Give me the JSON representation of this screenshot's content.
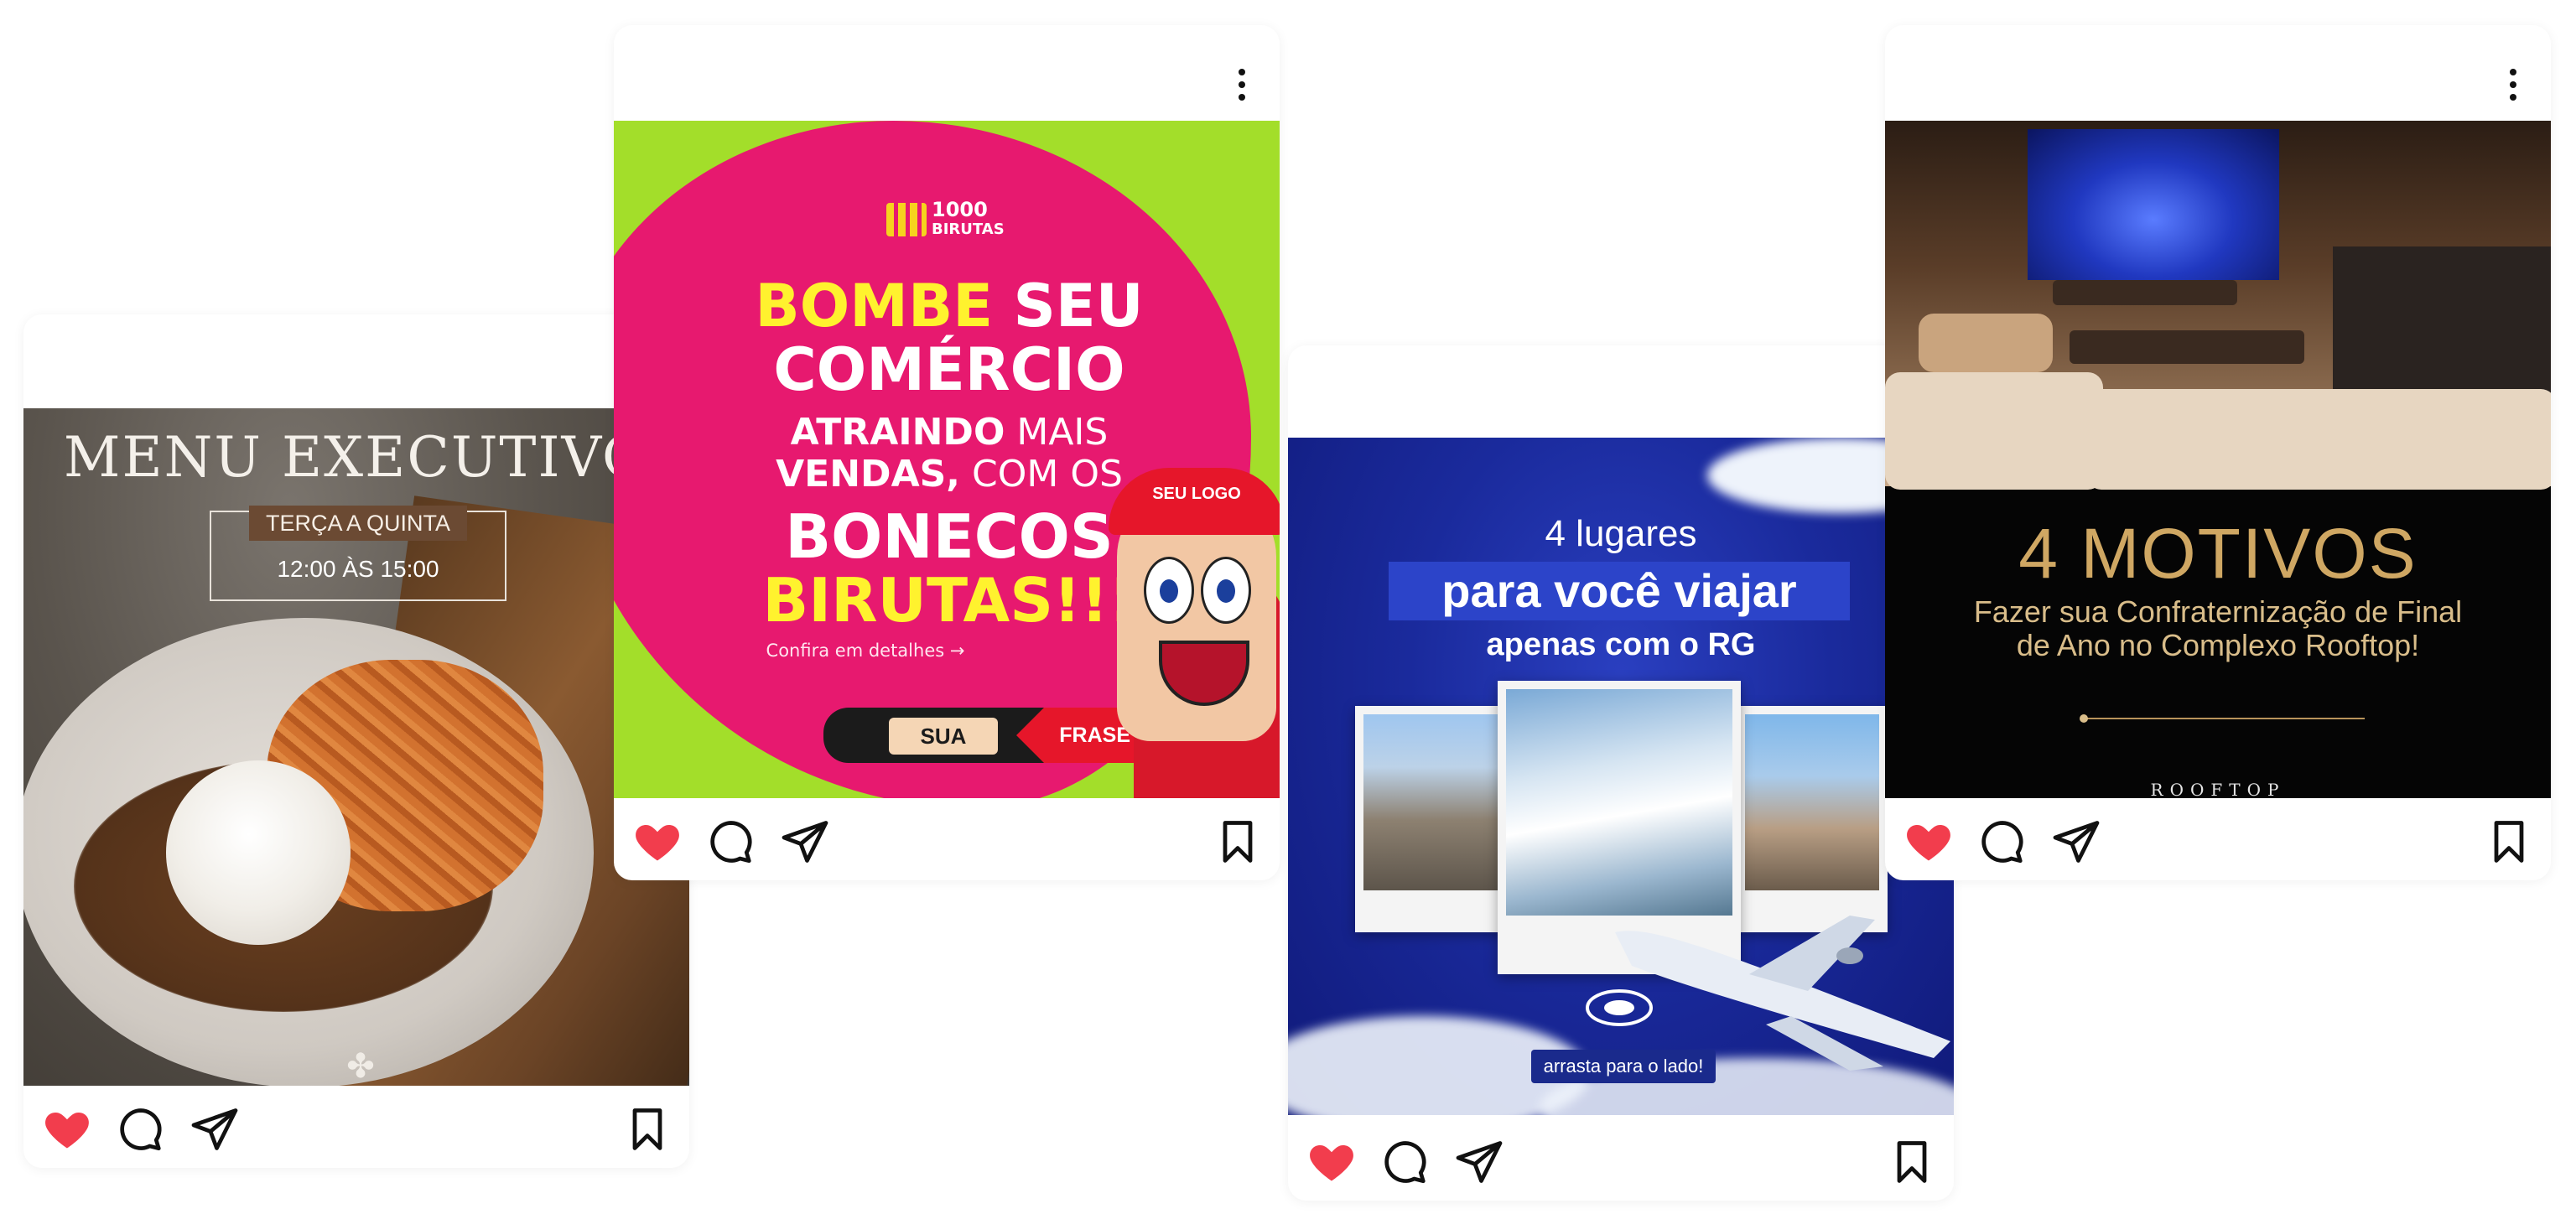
{
  "colors": {
    "heart": "#f23d4d",
    "icon": "#111111",
    "accent_pink": "#e7196f",
    "accent_green": "#a3de2a",
    "accent_gold": "#cfa763",
    "navy": "#1a2a9c"
  },
  "icons": {
    "like": "heart-icon",
    "comment": "comment-icon",
    "share": "send-icon",
    "save": "bookmark-icon",
    "more": "more-options-icon"
  },
  "post_menu": {
    "title": "MENU EXECUTIVO",
    "days": "TERÇA A QUINTA",
    "hours": "12:00 ÀS 15:00"
  },
  "post_birutas": {
    "logo_line1": "1000",
    "logo_line2": "BIRUTAS",
    "line1_a": "BOMBE",
    "line1_b": " SEU",
    "line2": "COMÉRCIO",
    "line3_a": "ATRAINDO",
    "line3_b": " MAIS",
    "line4_a": "VENDAS,",
    "line4_b": " COM OS",
    "line5": "BONECOS",
    "line6": "BIRUTAS!!!",
    "link": "Confira em detalhes →",
    "cap_label": "SEU LOGO",
    "sign_left": "SUA",
    "sign_right": "FRASE"
  },
  "post_travel": {
    "line1": "4 lugares",
    "line2": "para você viajar",
    "line3": "apenas com o RG",
    "swipe": "arrasta para o lado!"
  },
  "post_rooftop": {
    "title": "4 MOTIVOS",
    "subtitle": "Fazer sua Confraternização de Final de Ano no Complexo Rooftop!",
    "logo": "ROOFTOP"
  }
}
